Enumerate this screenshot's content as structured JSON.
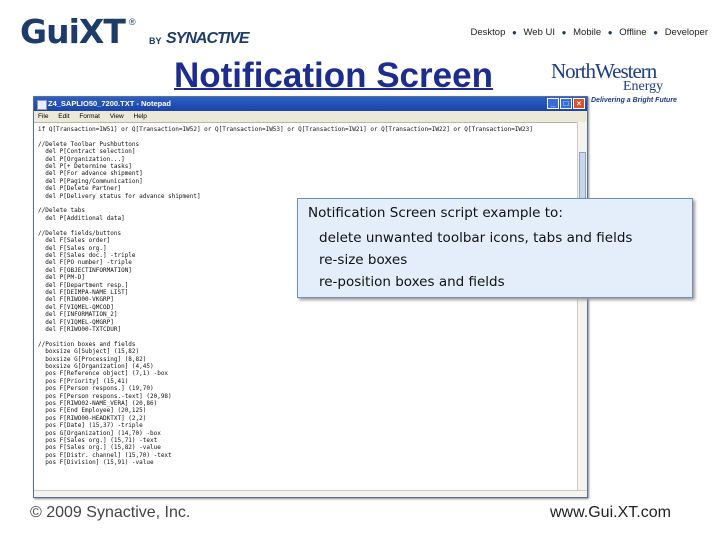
{
  "brand": {
    "logo_main": "GuiXT",
    "logo_reg": "®",
    "logo_by": "BY",
    "logo_company": "SYNACTIVE"
  },
  "topnav": [
    "Desktop",
    "Web UI",
    "Mobile",
    "Offline",
    "Developer"
  ],
  "title": "Notification Screen",
  "partner_logo": {
    "line1": "NorthWestern",
    "line2": "Energy",
    "tagline": "Delivering a Bright Future",
    "color": "#1d3c8a"
  },
  "notepad": {
    "window_title": "Z4_SAPLIO50_7200.TXT - Notepad",
    "menu": [
      "File",
      "Edit",
      "Format",
      "View",
      "Help"
    ],
    "content": "if Q[Transaction=IW51] or Q[Transaction=IW52] or Q[Transaction=IW53] or Q[Transaction=IW21] or Q[Transaction=IW22] or Q[Transaction=IW23]\n\n//Delete Toolbar Pushbuttons\n  del P[Contract selection]\n  del P[Organization...]\n  del P[+ Determine tasks]\n  del P[For advance shipment]\n  del P[Paging/Communication]\n  del P[Delete Partner]\n  del P[Delivery status for advance shipment]\n\n//Delete tabs\n  del P[Additional data]\n\n//Delete fields/buttons\n  del F[Sales order]\n  del F[Sales org.]\n  del F[Sales doc.] -triple\n  del F[PO number] -triple\n  del F[OBJECTINFORMATION]\n  del P[PM-D]\n  del F[Department resp.]\n  del F[DEIMPA-NAME LIST]\n  del F[RIWO00-VKGRP]\n  del F[VIQMEL-QMCOD]\n  del F[INFORMATION_2]\n  del F[VIQMEL-QMGRP]\n  del F[RIWO00-TXTCDUR]\n\n//Position boxes and fields\n  boxsize G[Subject] (15,82)\n  boxsize G[Processing] (8,82)\n  boxsize G[Organization] (4,45)\n  pos F[Reference object] (7,1) -box\n  pos F[Priority] (15,41)\n  pos F[Person respons.] (19,70)\n  pos F[Person respons.-text] (20,98)\n  pos F[RIWO02-NAME_VERA] (20,86)\n  pos F[End Employee] (20,125)\n  pos F[RIWO00-HEADKTXT] (2,2)\n  pos F[Date] (15,37) -triple\n  pos G[Organization] (14,70) -box\n  pos F[Sales org.] (15,71) -text\n  pos F[Sales org.] (15,82) -value\n  pos F[Distr. channel] (15,70) -text\n  pos F[Division] (15,91) -value"
  },
  "callout": {
    "heading": "Notification Screen script example to:",
    "items": [
      "delete unwanted toolbar icons, tabs and fields",
      "re-size boxes",
      "re-position boxes and fields"
    ]
  },
  "footer": {
    "copyright": "© 2009 Synactive, Inc.",
    "url": "www.Gui.XT.com"
  }
}
